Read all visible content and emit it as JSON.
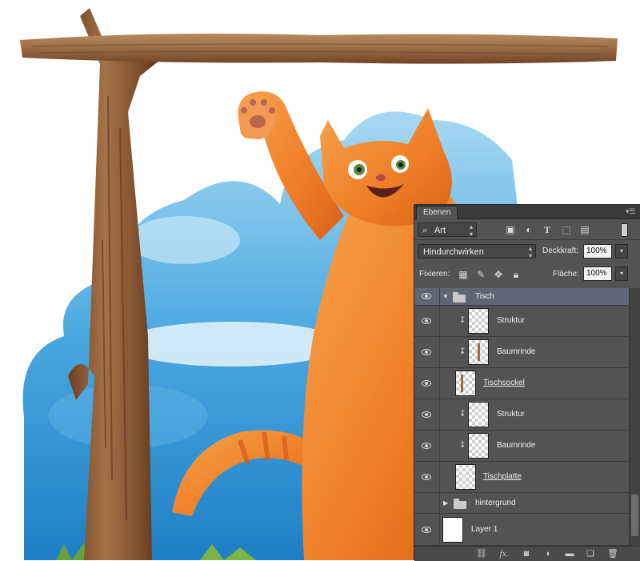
{
  "panel": {
    "tab_label": "Ebenen",
    "filter_kind": "Art",
    "blend_mode": "Hindurchwirken",
    "opacity_label": "Deckkraft:",
    "opacity_value": "100%",
    "lock_label": "Fixieren:",
    "fill_label": "Fläche:",
    "fill_value": "100%"
  },
  "layers": [
    {
      "name": "Tisch",
      "type": "group",
      "expanded": true,
      "selected": true
    },
    {
      "name": "Struktur",
      "type": "clipped"
    },
    {
      "name": "Baumrinde",
      "type": "clipped"
    },
    {
      "name": "Tischsockel",
      "type": "base"
    },
    {
      "name": "Struktur",
      "type": "clipped"
    },
    {
      "name": "Baumrinde",
      "type": "clipped"
    },
    {
      "name": "Tischplatte",
      "type": "base"
    },
    {
      "name": "hintergrund",
      "type": "group",
      "expanded": false
    },
    {
      "name": "Layer 1",
      "type": "plain"
    }
  ],
  "icons": {
    "search": "search-icon",
    "image_filter": "image-filter-icon",
    "adjustment_filter": "adjustment-filter-icon",
    "type_filter": "type-filter-icon",
    "shape_filter": "shape-filter-icon",
    "smartobject_filter": "smart-object-filter-icon",
    "toggle": "filter-toggle-icon",
    "link": "link-icon",
    "fx": "fx-icon",
    "mask": "mask-icon",
    "adjustment": "new-adjustment-icon",
    "group": "new-group-icon",
    "new_layer": "new-layer-icon",
    "trash": "trash-icon"
  },
  "footer": {
    "fx_label": "fx."
  },
  "colors": {
    "panel_bg": "#535353",
    "selected_row": "#5d6674",
    "sky_blue": "#3a9fd9",
    "cat_orange": "#f0822a",
    "wood_brown": "#8b5a35"
  }
}
